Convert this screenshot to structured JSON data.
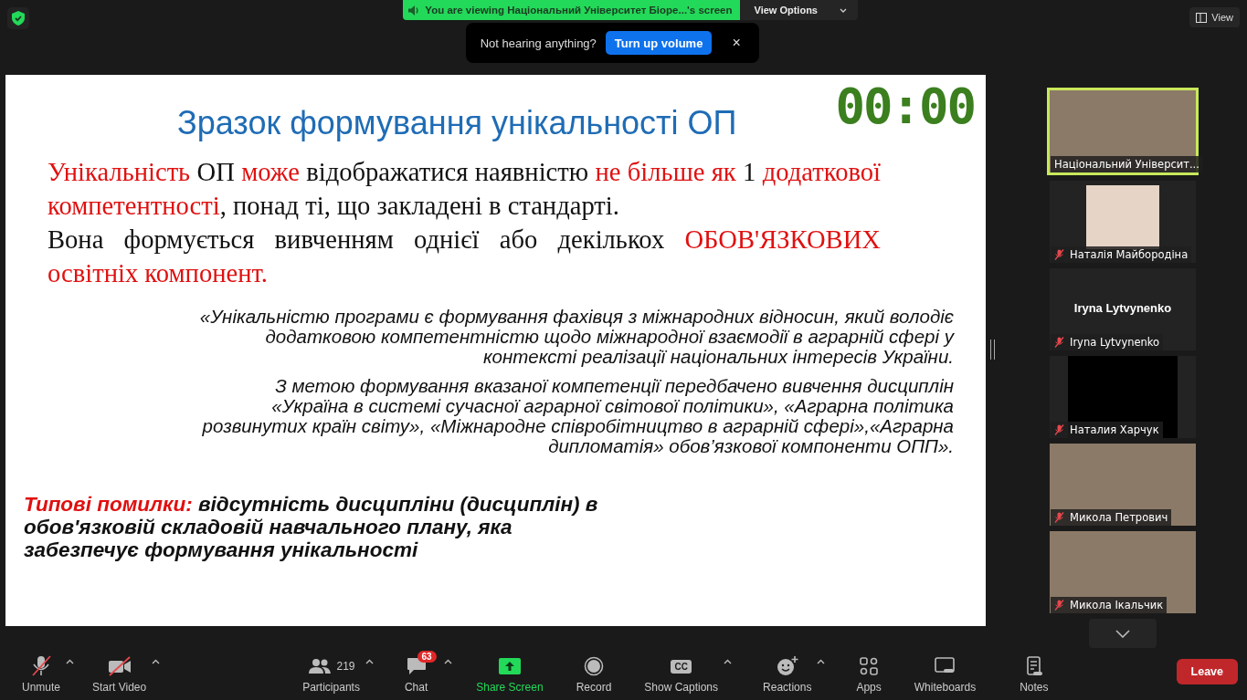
{
  "security_badge": {
    "on": true
  },
  "banner": {
    "text": "You are viewing Національний Університет Біоре...'s screen",
    "options": "View Options"
  },
  "notice": {
    "text": "Not hearing anything?",
    "button": "Turn up volume",
    "close": "×"
  },
  "view_button": "View",
  "slide": {
    "title": "Зразок формування унікальності ОП",
    "timer": "00:00",
    "paragraphs": [
      [
        {
          "text": "Унікальність",
          "emphasis": true
        },
        {
          "text": " ОП ",
          "emphasis": false
        },
        {
          "text": "може",
          "emphasis": true
        },
        {
          "text": " відображатися наявністю ",
          "emphasis": false
        },
        {
          "text": "не більше як",
          "emphasis": true
        },
        {
          "text": " 1 ",
          "emphasis": false
        },
        {
          "text": "додаткової компетентності",
          "emphasis": true
        },
        {
          "text": ", понад ті, що закладені в стандарті.",
          "emphasis": false
        }
      ],
      [
        {
          "text": "Вона формується вивченням однієї або декількох ",
          "emphasis": false
        },
        {
          "text": "ОБОВ'ЯЗКОВИХ освітніх компонент.",
          "emphasis": true
        }
      ]
    ],
    "quotes": [
      "«Унікальністю програми є формування фахівця з міжнародних відносин, який володіє додатковою компетентністю щодо міжнародної взаємодії в аграрній сфері у контексті реалізації національних інтересів України.",
      "З метою формування вказаної компетенції передбачено вивчення дисциплін «Україна в системі сучасної аграрної світової політики», «Аграрна політика розвинутих країн світу», «Міжнародне співробітництво в аграрній сфері»,«Аграрна дипломатія» обов’язкової компоненти ОПП»."
    ],
    "errors": [
      {
        "text": "Типові помилки:",
        "emphasis": true
      },
      {
        "text": " відсутність дисципліни (дисциплін) в обов'язковій складовій навчального плану, яка забезпечує формування унікальності",
        "emphasis": false
      }
    ]
  },
  "participants": [
    {
      "kind": "photo_full",
      "name": "Національний Університ...",
      "muted": false,
      "active": true
    },
    {
      "kind": "photo_small",
      "name": "Наталія Майбородіна",
      "muted": true,
      "active": false
    },
    {
      "kind": "name_only",
      "name": "Iryna Lytvynenko",
      "display": "Iryna Lytvynenko",
      "muted": true,
      "active": false
    },
    {
      "kind": "video_off",
      "name": "Наталия Харчук",
      "muted": true,
      "active": false
    },
    {
      "kind": "photo_full",
      "name": "Микола Петрович",
      "muted": true,
      "active": false
    },
    {
      "kind": "photo_full",
      "name": "Микола Ікальчик",
      "muted": true,
      "active": false
    }
  ],
  "toolbar": [
    {
      "kind": "mic",
      "label": "Unmute",
      "caret": true,
      "off": true
    },
    {
      "kind": "video",
      "label": "Start Video",
      "caret": true,
      "off": true
    },
    {
      "kind": "participants",
      "label": "Participants",
      "count": "219",
      "caret": true
    },
    {
      "kind": "chat",
      "label": "Chat",
      "badge": "63",
      "caret": true
    },
    {
      "kind": "share",
      "label": "Share Screen",
      "caret": false
    },
    {
      "kind": "record",
      "label": "Record",
      "caret": false
    },
    {
      "kind": "captions",
      "label": "Show Captions",
      "icon_text": "CC",
      "caret": true
    },
    {
      "kind": "reactions",
      "label": "Reactions",
      "caret": true
    },
    {
      "kind": "apps",
      "label": "Apps",
      "caret": false
    },
    {
      "kind": "whiteboards",
      "label": "Whiteboards",
      "caret": false
    },
    {
      "kind": "notes",
      "label": "Notes",
      "caret": false
    }
  ],
  "leave_button": "Leave"
}
